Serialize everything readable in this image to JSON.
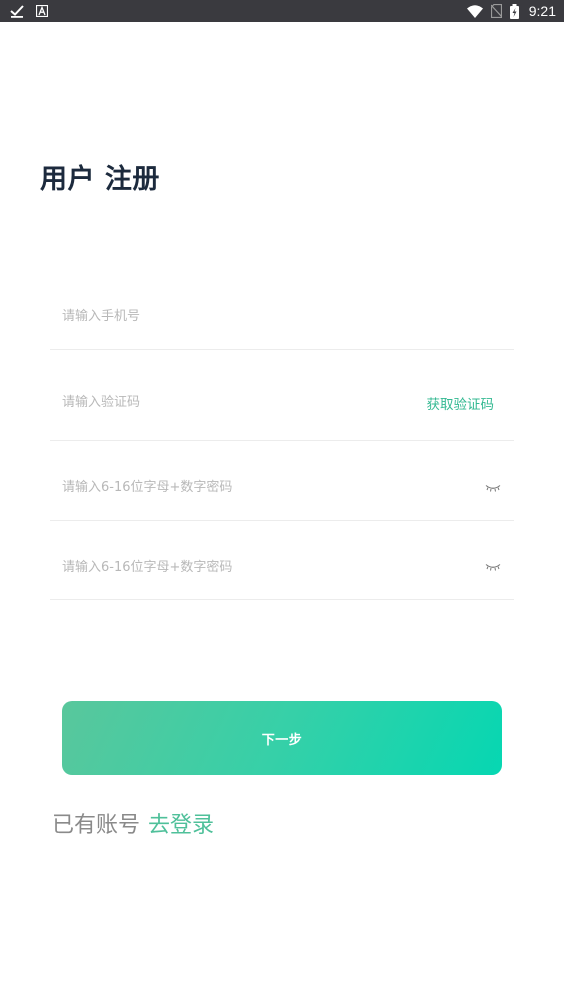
{
  "status_bar": {
    "time": "9:21",
    "left_icons": [
      "check-icon",
      "a-notification-icon"
    ],
    "right_icons": [
      "wifi-icon",
      "no-sim-icon",
      "battery-charging-icon"
    ]
  },
  "title": "用户 注册",
  "form": {
    "phone": {
      "placeholder": "请输入手机号",
      "value": ""
    },
    "code": {
      "placeholder": "请输入验证码",
      "value": "",
      "get_code_label": "获取验证码"
    },
    "password": {
      "placeholder": "请输入6-16位字母+数字密码",
      "value": ""
    },
    "confirm_password": {
      "placeholder": "请输入6-16位字母+数字密码",
      "value": ""
    }
  },
  "next_button": {
    "label": "下一步"
  },
  "login": {
    "prompt": "已有账号",
    "link": "去登录"
  },
  "colors": {
    "accent": "#4fc09a",
    "button_gradient_start": "#59c79c",
    "button_gradient_end": "#06d7b2",
    "title": "#1c2a3d",
    "status_bar": "#3a3a3f"
  }
}
